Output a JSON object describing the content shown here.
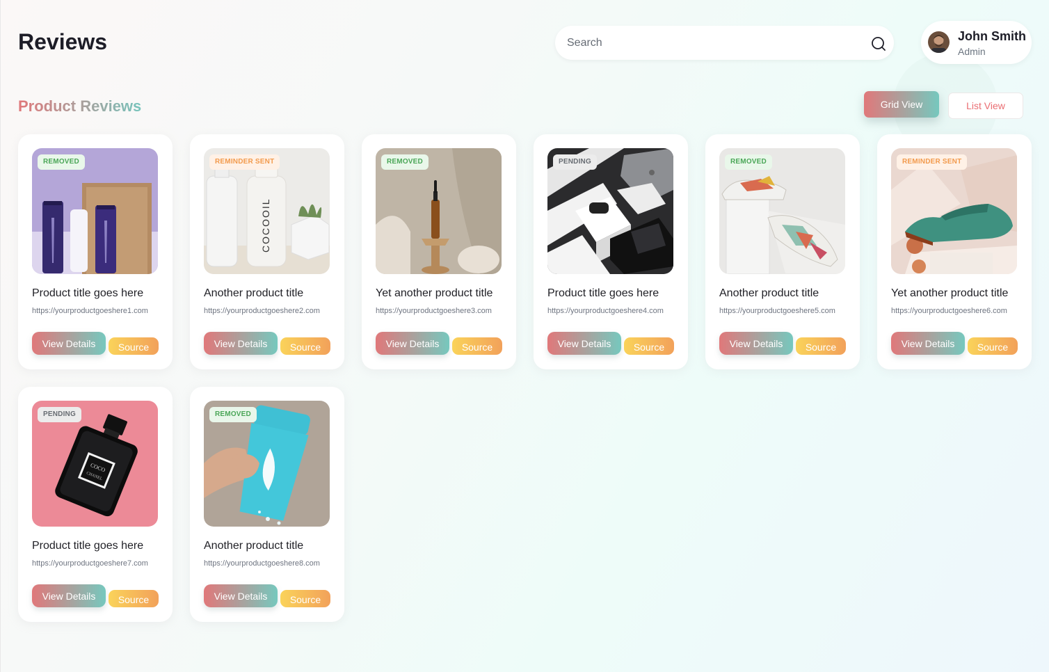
{
  "header": {
    "title": "Reviews",
    "search_placeholder": "Search",
    "search_icon": "search-icon"
  },
  "user": {
    "name": "John Smith",
    "role": "Admin"
  },
  "section": {
    "title": "Product Reviews",
    "grid_view_label": "Grid View",
    "list_view_label": "List View",
    "active_view": "grid"
  },
  "colors": {
    "accent_start": "#e0787a",
    "accent_end": "#76c8be",
    "source_start": "#fad35a",
    "source_end": "#f2a15a",
    "removed": "#4aa657",
    "reminder_sent": "#f29a4c",
    "pending": "#676c72"
  },
  "products": [
    {
      "title": "Product title goes here",
      "url": "https://yourproductgoeshere1.com",
      "status": "REMOVED",
      "status_type": "removed",
      "image": "skincare-tubes",
      "details_label": "View Details",
      "source_label": "Source"
    },
    {
      "title": "Another product title",
      "url": "https://yourproductgoeshere2.com",
      "status": "REMINDER SENT",
      "status_type": "reminder",
      "image": "body-oil-bottle",
      "details_label": "View Details",
      "source_label": "Source"
    },
    {
      "title": "Yet another product title",
      "url": "https://yourproductgoeshere3.com",
      "status": "REMOVED",
      "status_type": "removed",
      "image": "serum-dropper-bottle",
      "details_label": "View Details",
      "source_label": "Source"
    },
    {
      "title": "Product title goes here",
      "url": "https://yourproductgoeshere4.com",
      "status": "PENDING",
      "status_type": "pending",
      "image": "tech-gadgets",
      "details_label": "View Details",
      "source_label": "Source"
    },
    {
      "title": "Another product title",
      "url": "https://yourproductgoeshere5.com",
      "status": "REMOVED",
      "status_type": "removed",
      "image": "sneakers",
      "details_label": "View Details",
      "source_label": "Source"
    },
    {
      "title": "Yet another product title",
      "url": "https://yourproductgoeshere6.com",
      "status": "REMINDER SENT",
      "status_type": "reminder",
      "image": "green-shoe",
      "details_label": "View Details",
      "source_label": "Source"
    },
    {
      "title": "Product title goes here",
      "url": "https://yourproductgoeshere7.com",
      "status": "PENDING",
      "status_type": "pending",
      "image": "perfume-bottle",
      "details_label": "View Details",
      "source_label": "Source"
    },
    {
      "title": "Another product title",
      "url": "https://yourproductgoeshere8.com",
      "status": "REMOVED",
      "status_type": "removed",
      "image": "shaker-bottle",
      "details_label": "View Details",
      "source_label": "Source"
    }
  ]
}
